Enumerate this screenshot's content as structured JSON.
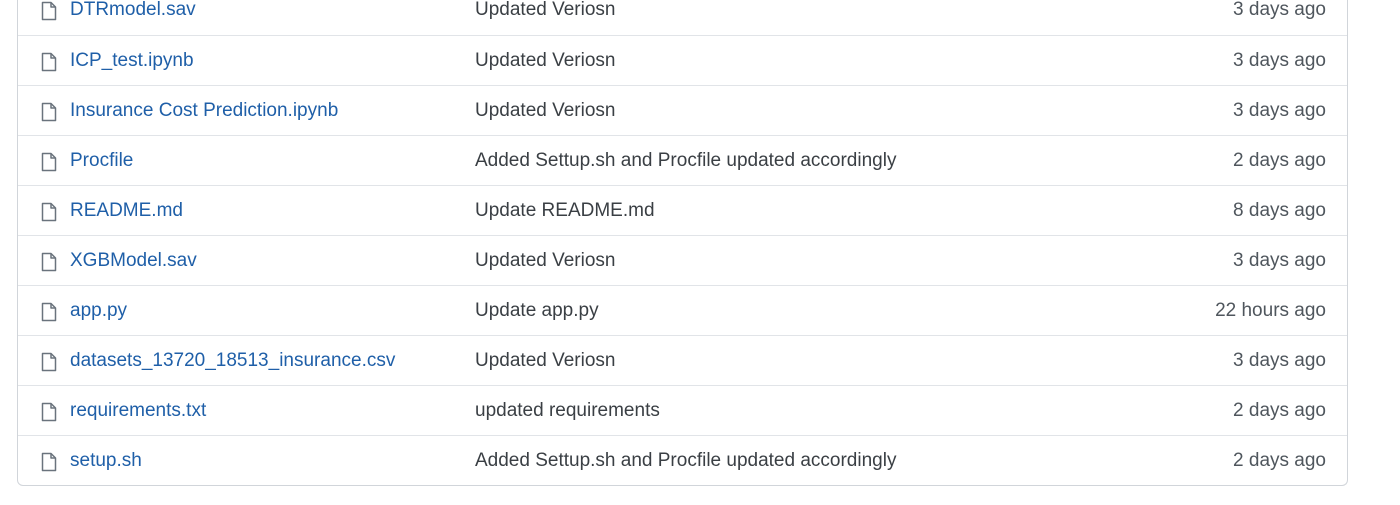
{
  "files": [
    {
      "name": "DTRmodel.sav",
      "message": "Updated Veriosn",
      "age": "3 days ago",
      "icon": "file-icon"
    },
    {
      "name": "ICP_test.ipynb",
      "message": "Updated Veriosn",
      "age": "3 days ago",
      "icon": "file-icon"
    },
    {
      "name": "Insurance Cost Prediction.ipynb",
      "message": "Updated Veriosn",
      "age": "3 days ago",
      "icon": "file-icon"
    },
    {
      "name": "Procfile",
      "message": "Added Settup.sh and Procfile updated accordingly",
      "age": "2 days ago",
      "icon": "file-icon"
    },
    {
      "name": "README.md",
      "message": "Update README.md",
      "age": "8 days ago",
      "icon": "file-icon"
    },
    {
      "name": "XGBModel.sav",
      "message": "Updated Veriosn",
      "age": "3 days ago",
      "icon": "file-icon"
    },
    {
      "name": "app.py",
      "message": "Update app.py",
      "age": "22 hours ago",
      "icon": "file-icon"
    },
    {
      "name": "datasets_13720_18513_insurance.csv",
      "message": "Updated Veriosn",
      "age": "3 days ago",
      "icon": "file-icon"
    },
    {
      "name": "requirements.txt",
      "message": "updated requirements",
      "age": "2 days ago",
      "icon": "file-icon"
    },
    {
      "name": "setup.sh",
      "message": "Added Settup.sh and Procfile updated accordingly",
      "age": "2 days ago",
      "icon": "file-icon"
    }
  ],
  "colors": {
    "link": "#1f5fa8",
    "text": "#3a3f44",
    "muted": "#4f565d",
    "border": "#e1e4e8"
  }
}
